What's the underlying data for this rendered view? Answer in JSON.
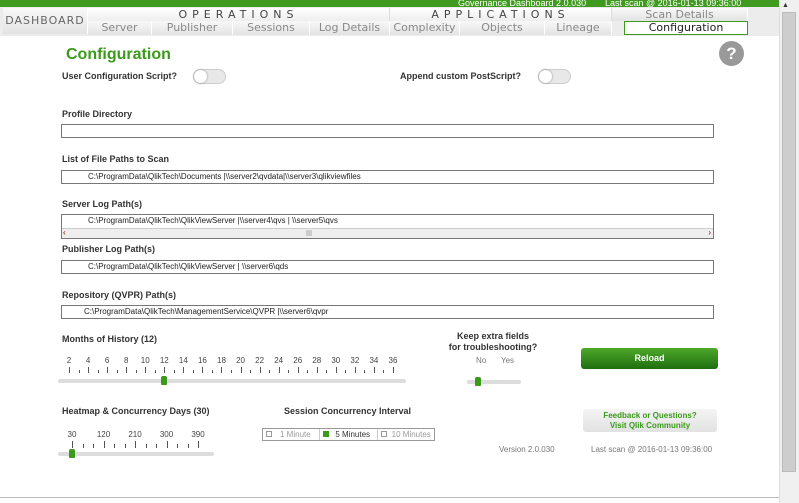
{
  "topbar": {
    "app": "Governance Dashboard 2.0.030",
    "last_scan": "Last scan @ 2016-01-13 09:36:00"
  },
  "nav": {
    "dashboard": "DASHBOARD",
    "operations": "OPERATIONS",
    "applications": "APPLICATIONS",
    "scan_details": "Scan Details",
    "tabs": [
      "Server",
      "Publisher",
      "Sessions",
      "Log Details",
      "Complexity",
      "Objects",
      "Lineage",
      "Configuration"
    ],
    "active": "Configuration"
  },
  "page": {
    "title": "Configuration",
    "help": "?"
  },
  "toggles": {
    "user_script": "User Configuration Script?",
    "append_postscript": "Append custom PostScript?"
  },
  "fields": {
    "profile_label": "Profile Directory",
    "profile_value": "",
    "files_label": "List of File Paths to Scan",
    "files_value": "C:\\ProgramData\\QlikTech\\Documents     |\\\\server2\\qvdata|\\\\server3\\qlikviewfiles",
    "server_label": "Server Log Path(s)",
    "server_value": "C:\\ProgramData\\QlikTech\\QlikViewServer    |\\\\server4\\qvs  |  \\\\server5\\qvs",
    "publisher_label": "Publisher Log Path(s)",
    "publisher_value": "C:\\ProgramData\\QlikTech\\QlikViewServer   | \\\\server6\\qds",
    "repo_label": "Repository (QVPR) Path(s)",
    "repo_value": "C:\\ProgramData\\QlikTech\\ManagementService\\QVPR     |\\\\server6\\qvpr"
  },
  "months": {
    "label": "Months of History (12)",
    "ticks": [
      "2",
      "4",
      "6",
      "8",
      "10",
      "12",
      "14",
      "16",
      "18",
      "20",
      "22",
      "24",
      "26",
      "28",
      "30",
      "32",
      "34",
      "36"
    ],
    "value": 12,
    "min": 1,
    "max": 36
  },
  "heatmap": {
    "label": "Heatmap & Concurrency Days (30)",
    "ticks": [
      "30",
      "120",
      "210",
      "300",
      "390"
    ],
    "value": 30,
    "min": 30,
    "max": 390
  },
  "extra": {
    "label1": "Keep extra fields",
    "label2": "for troubleshooting?",
    "no": "No",
    "yes": "Yes",
    "value": "No"
  },
  "interval": {
    "label": "Session Concurrency Interval",
    "options": [
      "1 Minute",
      "5 Minutes",
      "10 Minutes"
    ],
    "selected": "5 Minutes"
  },
  "reload": "Reload",
  "feedback": {
    "line1": "Feedback or Questions?",
    "line2": "Visit Qlik Community"
  },
  "footer": {
    "version": "Version 2.0.030",
    "last_scan": "Last scan @ 2016-01-13 09:36:00"
  }
}
